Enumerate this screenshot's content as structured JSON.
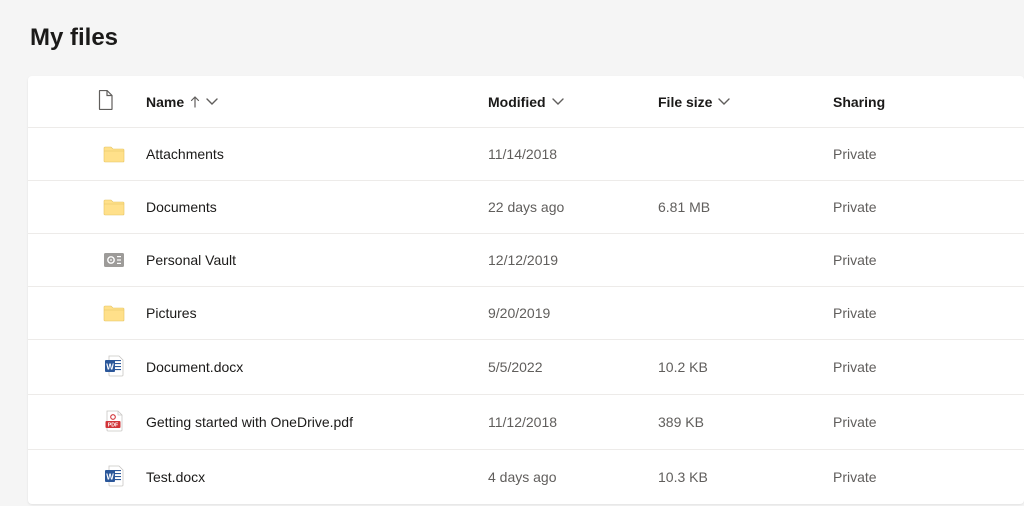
{
  "page": {
    "title": "My files"
  },
  "columns": {
    "name": "Name",
    "modified": "Modified",
    "size": "File size",
    "sharing": "Sharing"
  },
  "files": [
    {
      "icon": "folder",
      "name": "Attachments",
      "modified": "11/14/2018",
      "size": "",
      "sharing": "Private"
    },
    {
      "icon": "folder",
      "name": "Documents",
      "modified": "22 days ago",
      "size": "6.81 MB",
      "sharing": "Private"
    },
    {
      "icon": "personal-vault",
      "name": "Personal Vault",
      "modified": "12/12/2019",
      "size": "",
      "sharing": "Private"
    },
    {
      "icon": "folder",
      "name": "Pictures",
      "modified": "9/20/2019",
      "size": "",
      "sharing": "Private"
    },
    {
      "icon": "word",
      "name": "Document.docx",
      "modified": "5/5/2022",
      "size": "10.2 KB",
      "sharing": "Private"
    },
    {
      "icon": "pdf",
      "name": "Getting started with OneDrive.pdf",
      "modified": "11/12/2018",
      "size": "389 KB",
      "sharing": "Private"
    },
    {
      "icon": "word",
      "name": "Test.docx",
      "modified": "4 days ago",
      "size": "10.3 KB",
      "sharing": "Private"
    }
  ]
}
